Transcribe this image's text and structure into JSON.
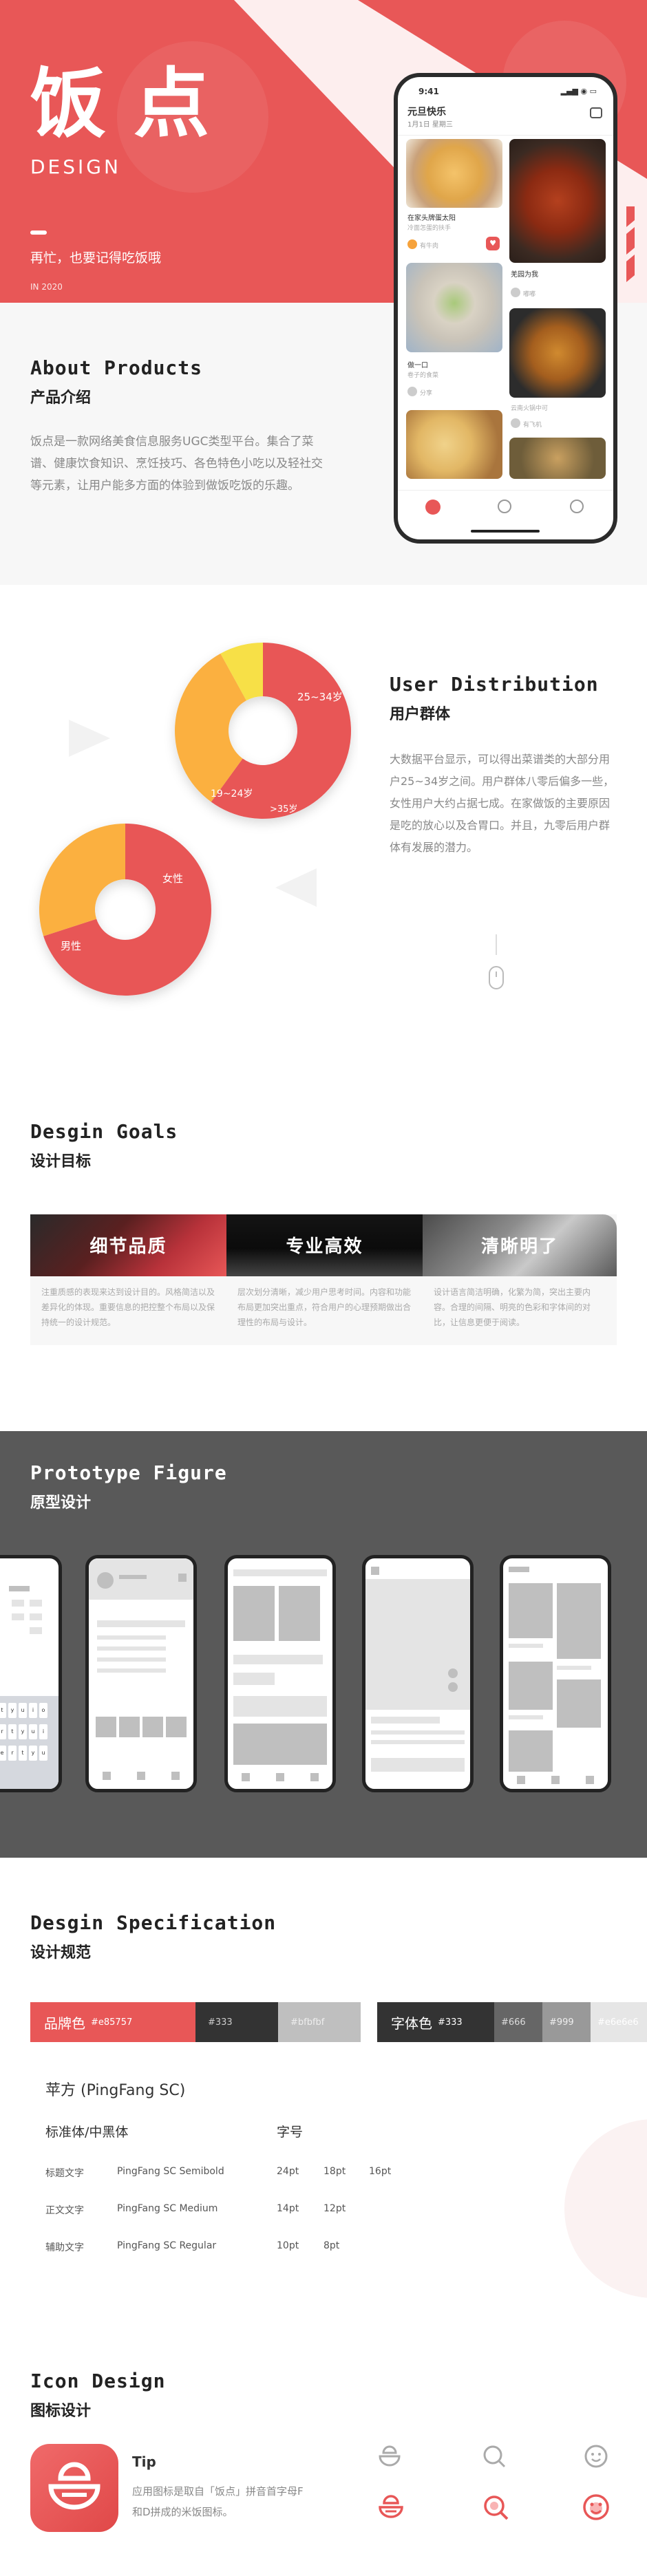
{
  "colors": {
    "brand": "#e85757",
    "dark": "#333333",
    "gray": "#bfbfbf",
    "text2": "#666666",
    "text3": "#999999",
    "light": "#e6e6e6",
    "orange": "#fbb040",
    "yellow": "#f7e047"
  },
  "hero": {
    "logo_char1": "饭",
    "logo_char2": "点",
    "logo_en": "DESIGN",
    "tagline": "再忙，也要记得吃饭哦",
    "year": "IN 2020",
    "phone": {
      "time": "9:41",
      "title": "元旦快乐",
      "date": "1月1日 星期三",
      "cards": [
        {
          "title": "在家头牌蛋太阳",
          "sub": "冷面怎蛋的扶手",
          "user": "有牛肉"
        },
        {
          "title": "羌园为我",
          "sub": "",
          "user": "嘟嘟"
        },
        {
          "title": "做一口",
          "sub": "卷子的食菜",
          "user": "分享"
        },
        {
          "title": "",
          "sub": "云南火锅中可",
          "user": "有飞机"
        }
      ]
    }
  },
  "about": {
    "title_en": "About Products",
    "title_zh": "产品介绍",
    "body": "饭点是一款网络美食信息服务UGC类型平台。集合了菜谱、健康饮食知识、烹饪技巧、各色特色小吃以及轻社交等元素，让用户能多方面的体验到做饭吃饭的乐趣。"
  },
  "distribution": {
    "title_en": "User Distribution",
    "title_zh": "用户群体",
    "body": "大数据平台显示，可以得出菜谱类的大部分用户25~34岁之间。用户群体八零后偏多一些，女性用户大约占据七成。在家做饭的主要原因是吃的放心以及合胃口。并且，九零后用户群体有发展的潜力。",
    "age_labels": [
      "25~34岁",
      "19~24岁",
      ">35岁"
    ],
    "age_values": [
      60,
      32,
      8
    ],
    "gender_labels": [
      "女性",
      "男性"
    ],
    "gender_values": [
      70,
      30
    ]
  },
  "goals": {
    "title_en": "Desgin Goals",
    "title_zh": "设计目标",
    "cards": [
      {
        "title": "细节品质",
        "text": "注重质感的表现来达到设计目的。风格简洁以及差异化的体现。重要信息的把控整个布局以及保持统一的设计规范。"
      },
      {
        "title": "专业高效",
        "text": "层次划分清晰，减少用户思考时间。内容和功能布局更加突出重点，符合用户的心理预期做出合理性的布局与设计。"
      },
      {
        "title": "清晰明了",
        "text": "设计语言简洁明确，化繁为简，突出主要内容。合理的间隔、明亮的色彩和字体间的对比，让信息更便于阅读。"
      }
    ]
  },
  "prototype": {
    "title_en": "Prototype Figure",
    "title_zh": "原型设计",
    "keyboard": [
      "q",
      "w",
      "e",
      "r",
      "t",
      "y",
      "u",
      "i",
      "o",
      "p"
    ]
  },
  "spec": {
    "title_en": "Desgin Specification",
    "title_zh": "设计规范",
    "brand_label": "品牌色",
    "brand_hex": "#e85757",
    "brand_hex2": "#333",
    "brand_hex3": "#bfbfbf",
    "font_label": "字体色",
    "font_hex1": "#333",
    "font_hex2": "#666",
    "font_hex3": "#999",
    "font_hex4": "#e6e6e6",
    "font_name": "苹方 (PingFang SC)",
    "col1": "标准体/中黑体",
    "col2": "字号",
    "rows": [
      {
        "name": "标题文字",
        "font": "PingFang SC Semibold",
        "sizes": [
          "24pt",
          "18pt",
          "16pt"
        ]
      },
      {
        "name": "正文文字",
        "font": "PingFang SC Medium",
        "sizes": [
          "14pt",
          "12pt",
          ""
        ]
      },
      {
        "name": "辅助文字",
        "font": "PingFang SC Regular",
        "sizes": [
          "10pt",
          "8pt",
          ""
        ]
      }
    ]
  },
  "icon": {
    "title_en": "Icon Design",
    "title_zh": "图标设计",
    "tip_title": "Tip",
    "tip_text": "应用图标是取自「饭点」拼音首字母F和D拼成的米饭图标。"
  }
}
